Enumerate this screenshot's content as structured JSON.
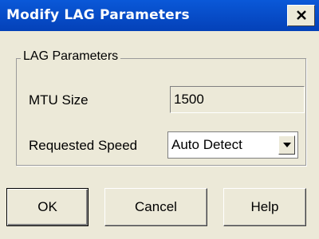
{
  "window": {
    "title": "Modify LAG Parameters",
    "close_icon": "close-icon"
  },
  "group": {
    "legend": "LAG Parameters",
    "fields": {
      "mtu_label": "MTU Size",
      "mtu_value": "1500",
      "speed_label": "Requested Speed",
      "speed_value": "Auto Detect",
      "speed_icon": "chevron-down-icon"
    }
  },
  "buttons": {
    "ok": "OK",
    "cancel": "Cancel",
    "help": "Help"
  },
  "colors": {
    "titlebar": "#0a58d8",
    "dialog_bg": "#ece9d8"
  }
}
